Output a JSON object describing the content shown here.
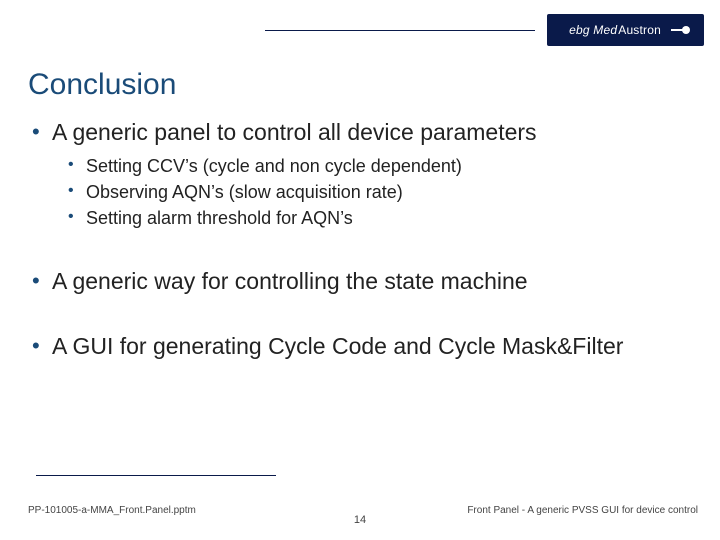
{
  "logo": {
    "ebg": "ebg ",
    "med": "Med",
    "austron": "Austron"
  },
  "title": "Conclusion",
  "bullets": {
    "b1": {
      "text": "A generic panel to control all device parameters",
      "sub": {
        "s1": "Setting CCV’s (cycle and non cycle dependent)",
        "s2": "Observing AQN’s (slow acquisition rate)",
        "s3": "Setting alarm threshold for AQN’s"
      }
    },
    "b2": {
      "text": "A generic way for controlling the state machine"
    },
    "b3": {
      "text": "A GUI for generating Cycle Code and Cycle Mask&Filter"
    }
  },
  "footer": {
    "left": "PP-101005-a-MMA_Front.Panel.pptm",
    "page": "14",
    "right": "Front Panel - A generic PVSS GUI for device control"
  }
}
